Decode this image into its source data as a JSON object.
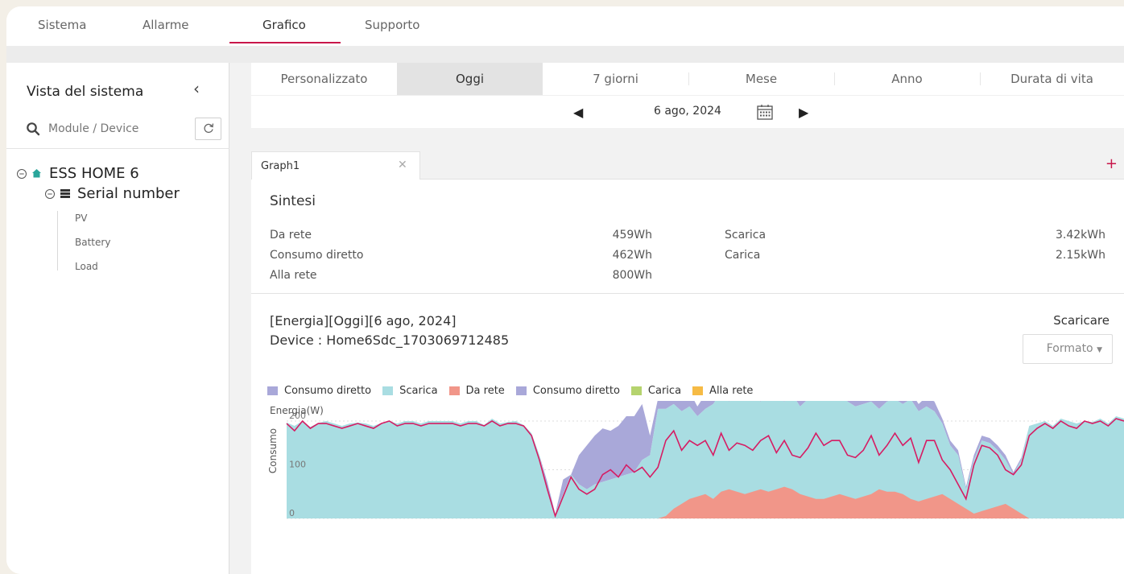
{
  "topnav": {
    "tabs": [
      {
        "label": "Sistema",
        "active": false
      },
      {
        "label": "Allarme",
        "active": false
      },
      {
        "label": "Grafico",
        "active": true
      },
      {
        "label": "Supporto",
        "active": false
      }
    ],
    "accent_color": "#c8164a"
  },
  "sidebar": {
    "title": "Vista del sistema",
    "search_placeholder": "Module / Device",
    "tree": {
      "root_label": "ESS HOME 6",
      "child_label": "Serial number",
      "leaves": [
        "PV",
        "Battery",
        "Load"
      ]
    }
  },
  "period": {
    "tabs": [
      {
        "label": "Personalizzato",
        "active": false
      },
      {
        "label": "Oggi",
        "active": true
      },
      {
        "label": "7 giorni",
        "active": false
      },
      {
        "label": "Mese",
        "active": false
      },
      {
        "label": "Anno",
        "active": false
      },
      {
        "label": "Durata di vita",
        "active": false
      }
    ],
    "date": "6 ago, 2024"
  },
  "graph_tab": {
    "label": "Graph1"
  },
  "summary": {
    "title": "Sintesi",
    "left": [
      {
        "label": "Da rete",
        "value": "459Wh"
      },
      {
        "label": "Consumo diretto",
        "value": "462Wh"
      },
      {
        "label": "Alla rete",
        "value": "800Wh"
      }
    ],
    "right": [
      {
        "label": "Scarica",
        "value": "3.42kWh"
      },
      {
        "label": "Carica",
        "value": "2.15kWh"
      }
    ]
  },
  "chart_header": {
    "line1": "[Energia][Oggi][6 ago, 2024]",
    "line2": "Device : Home6Sdc_1703069712485",
    "download_label": "Scaricare",
    "format_label": "Formato"
  },
  "chart_data": {
    "type": "area",
    "title": "",
    "ylabel": "Consumo",
    "yunit": "Energia(W)",
    "ylim": [
      0,
      400
    ],
    "yticks": [
      "0",
      "100",
      "200"
    ],
    "legend_placement": "top-left",
    "legend": [
      {
        "name": "Consumo diretto",
        "color": "#a9a8d9"
      },
      {
        "name": "Scarica",
        "color": "#a9dde2"
      },
      {
        "name": "Da rete",
        "color": "#f19689"
      },
      {
        "name": "Consumo diretto",
        "color": "#a9a8d9"
      },
      {
        "name": "Carica",
        "color": "#b5d36e"
      },
      {
        "name": "Alla rete",
        "color": "#f6bb45"
      }
    ],
    "x": [
      0,
      10,
      20,
      30,
      40,
      50,
      60,
      70,
      80,
      90,
      100,
      110,
      120,
      130,
      140,
      150,
      160,
      170,
      180,
      190,
      200,
      210,
      220,
      230,
      240,
      250,
      260,
      270,
      280,
      290,
      300,
      310,
      320,
      330,
      340,
      350,
      360,
      370,
      380,
      390,
      400,
      410,
      420,
      430,
      440,
      450,
      460,
      470,
      480,
      490,
      500,
      510,
      520,
      530,
      540,
      550,
      560,
      570,
      580,
      590,
      600,
      610,
      620,
      630,
      640,
      650,
      660,
      670,
      680,
      690,
      700,
      710,
      720,
      730,
      740,
      750,
      760,
      770,
      780,
      790,
      800,
      810,
      820,
      830,
      840,
      850,
      860,
      870,
      880,
      890,
      900,
      910,
      920,
      930,
      940,
      950,
      960,
      970,
      980,
      990,
      1000,
      1010,
      1020,
      1030,
      1040,
      1050,
      1060
    ],
    "series": [
      {
        "name": "Scarica",
        "values": [
          197,
          190,
          200,
          188,
          196,
          200,
          195,
          190,
          195,
          197,
          195,
          190,
          196,
          200,
          195,
          200,
          200,
          195,
          200,
          200,
          200,
          200,
          195,
          200,
          200,
          192,
          205,
          195,
          198,
          200,
          192,
          175,
          130,
          60,
          10,
          50,
          90,
          70,
          60,
          70,
          75,
          80,
          85,
          90,
          95,
          120,
          130,
          225,
          225,
          235,
          220,
          230,
          210,
          225,
          235,
          260,
          240,
          250,
          245,
          250,
          240,
          265,
          250,
          240,
          255,
          230,
          245,
          260,
          250,
          245,
          260,
          240,
          230,
          235,
          240,
          225,
          240,
          245,
          235,
          245,
          220,
          230,
          220,
          195,
          150,
          130,
          60,
          120,
          160,
          155,
          140,
          120,
          90,
          120,
          190,
          195,
          200,
          190,
          205,
          200,
          195,
          200,
          198,
          205,
          195,
          210,
          205
        ]
      },
      {
        "name": "Consumo diretto",
        "values": [
          0,
          0,
          0,
          0,
          0,
          0,
          0,
          0,
          0,
          0,
          0,
          0,
          0,
          0,
          0,
          0,
          0,
          0,
          0,
          0,
          0,
          0,
          0,
          0,
          0,
          0,
          0,
          0,
          0,
          0,
          0,
          0,
          0,
          15,
          0,
          30,
          0,
          60,
          90,
          100,
          110,
          100,
          105,
          120,
          115,
          115,
          40,
          20,
          25,
          30,
          50,
          30,
          20,
          30,
          40,
          20,
          30,
          30,
          20,
          30,
          25,
          20,
          40,
          40,
          30,
          45,
          30,
          20,
          25,
          30,
          20,
          25,
          20,
          25,
          20,
          25,
          20,
          20,
          20,
          15,
          15,
          20,
          20,
          10,
          10,
          10,
          5,
          10,
          10,
          10,
          10,
          10,
          5,
          5,
          0,
          0,
          0,
          0,
          0,
          0,
          0,
          0,
          0,
          0,
          0,
          0,
          0
        ]
      },
      {
        "name": "Da rete",
        "values": [
          0,
          0,
          0,
          0,
          0,
          0,
          0,
          0,
          0,
          0,
          0,
          0,
          0,
          0,
          0,
          0,
          0,
          0,
          0,
          0,
          0,
          0,
          0,
          0,
          0,
          0,
          0,
          0,
          0,
          0,
          0,
          0,
          0,
          0,
          0,
          0,
          0,
          0,
          0,
          0,
          0,
          0,
          0,
          0,
          0,
          0,
          0,
          0,
          5,
          20,
          30,
          40,
          45,
          50,
          40,
          55,
          60,
          55,
          50,
          55,
          60,
          55,
          60,
          65,
          60,
          50,
          45,
          40,
          40,
          45,
          50,
          45,
          40,
          45,
          50,
          60,
          55,
          55,
          50,
          40,
          35,
          40,
          45,
          50,
          40,
          30,
          20,
          10,
          15,
          20,
          25,
          30,
          20,
          10,
          0,
          0,
          0,
          0,
          0,
          0,
          0,
          0,
          0,
          0,
          0,
          0,
          0
        ]
      },
      {
        "name": "Consumo",
        "values": [
          195,
          180,
          200,
          185,
          195,
          195,
          190,
          185,
          190,
          195,
          190,
          185,
          195,
          200,
          190,
          195,
          195,
          190,
          195,
          195,
          195,
          195,
          190,
          195,
          195,
          190,
          200,
          190,
          195,
          195,
          190,
          170,
          120,
          60,
          5,
          45,
          85,
          60,
          50,
          60,
          90,
          100,
          85,
          110,
          95,
          105,
          85,
          105,
          160,
          180,
          140,
          160,
          150,
          160,
          130,
          175,
          140,
          155,
          150,
          140,
          160,
          170,
          135,
          160,
          130,
          125,
          145,
          175,
          150,
          160,
          160,
          130,
          125,
          140,
          170,
          130,
          150,
          175,
          150,
          165,
          115,
          160,
          160,
          120,
          100,
          70,
          40,
          110,
          150,
          145,
          130,
          100,
          90,
          110,
          170,
          185,
          195,
          185,
          200,
          190,
          185,
          200,
          195,
          200,
          190,
          205,
          200
        ]
      }
    ]
  }
}
